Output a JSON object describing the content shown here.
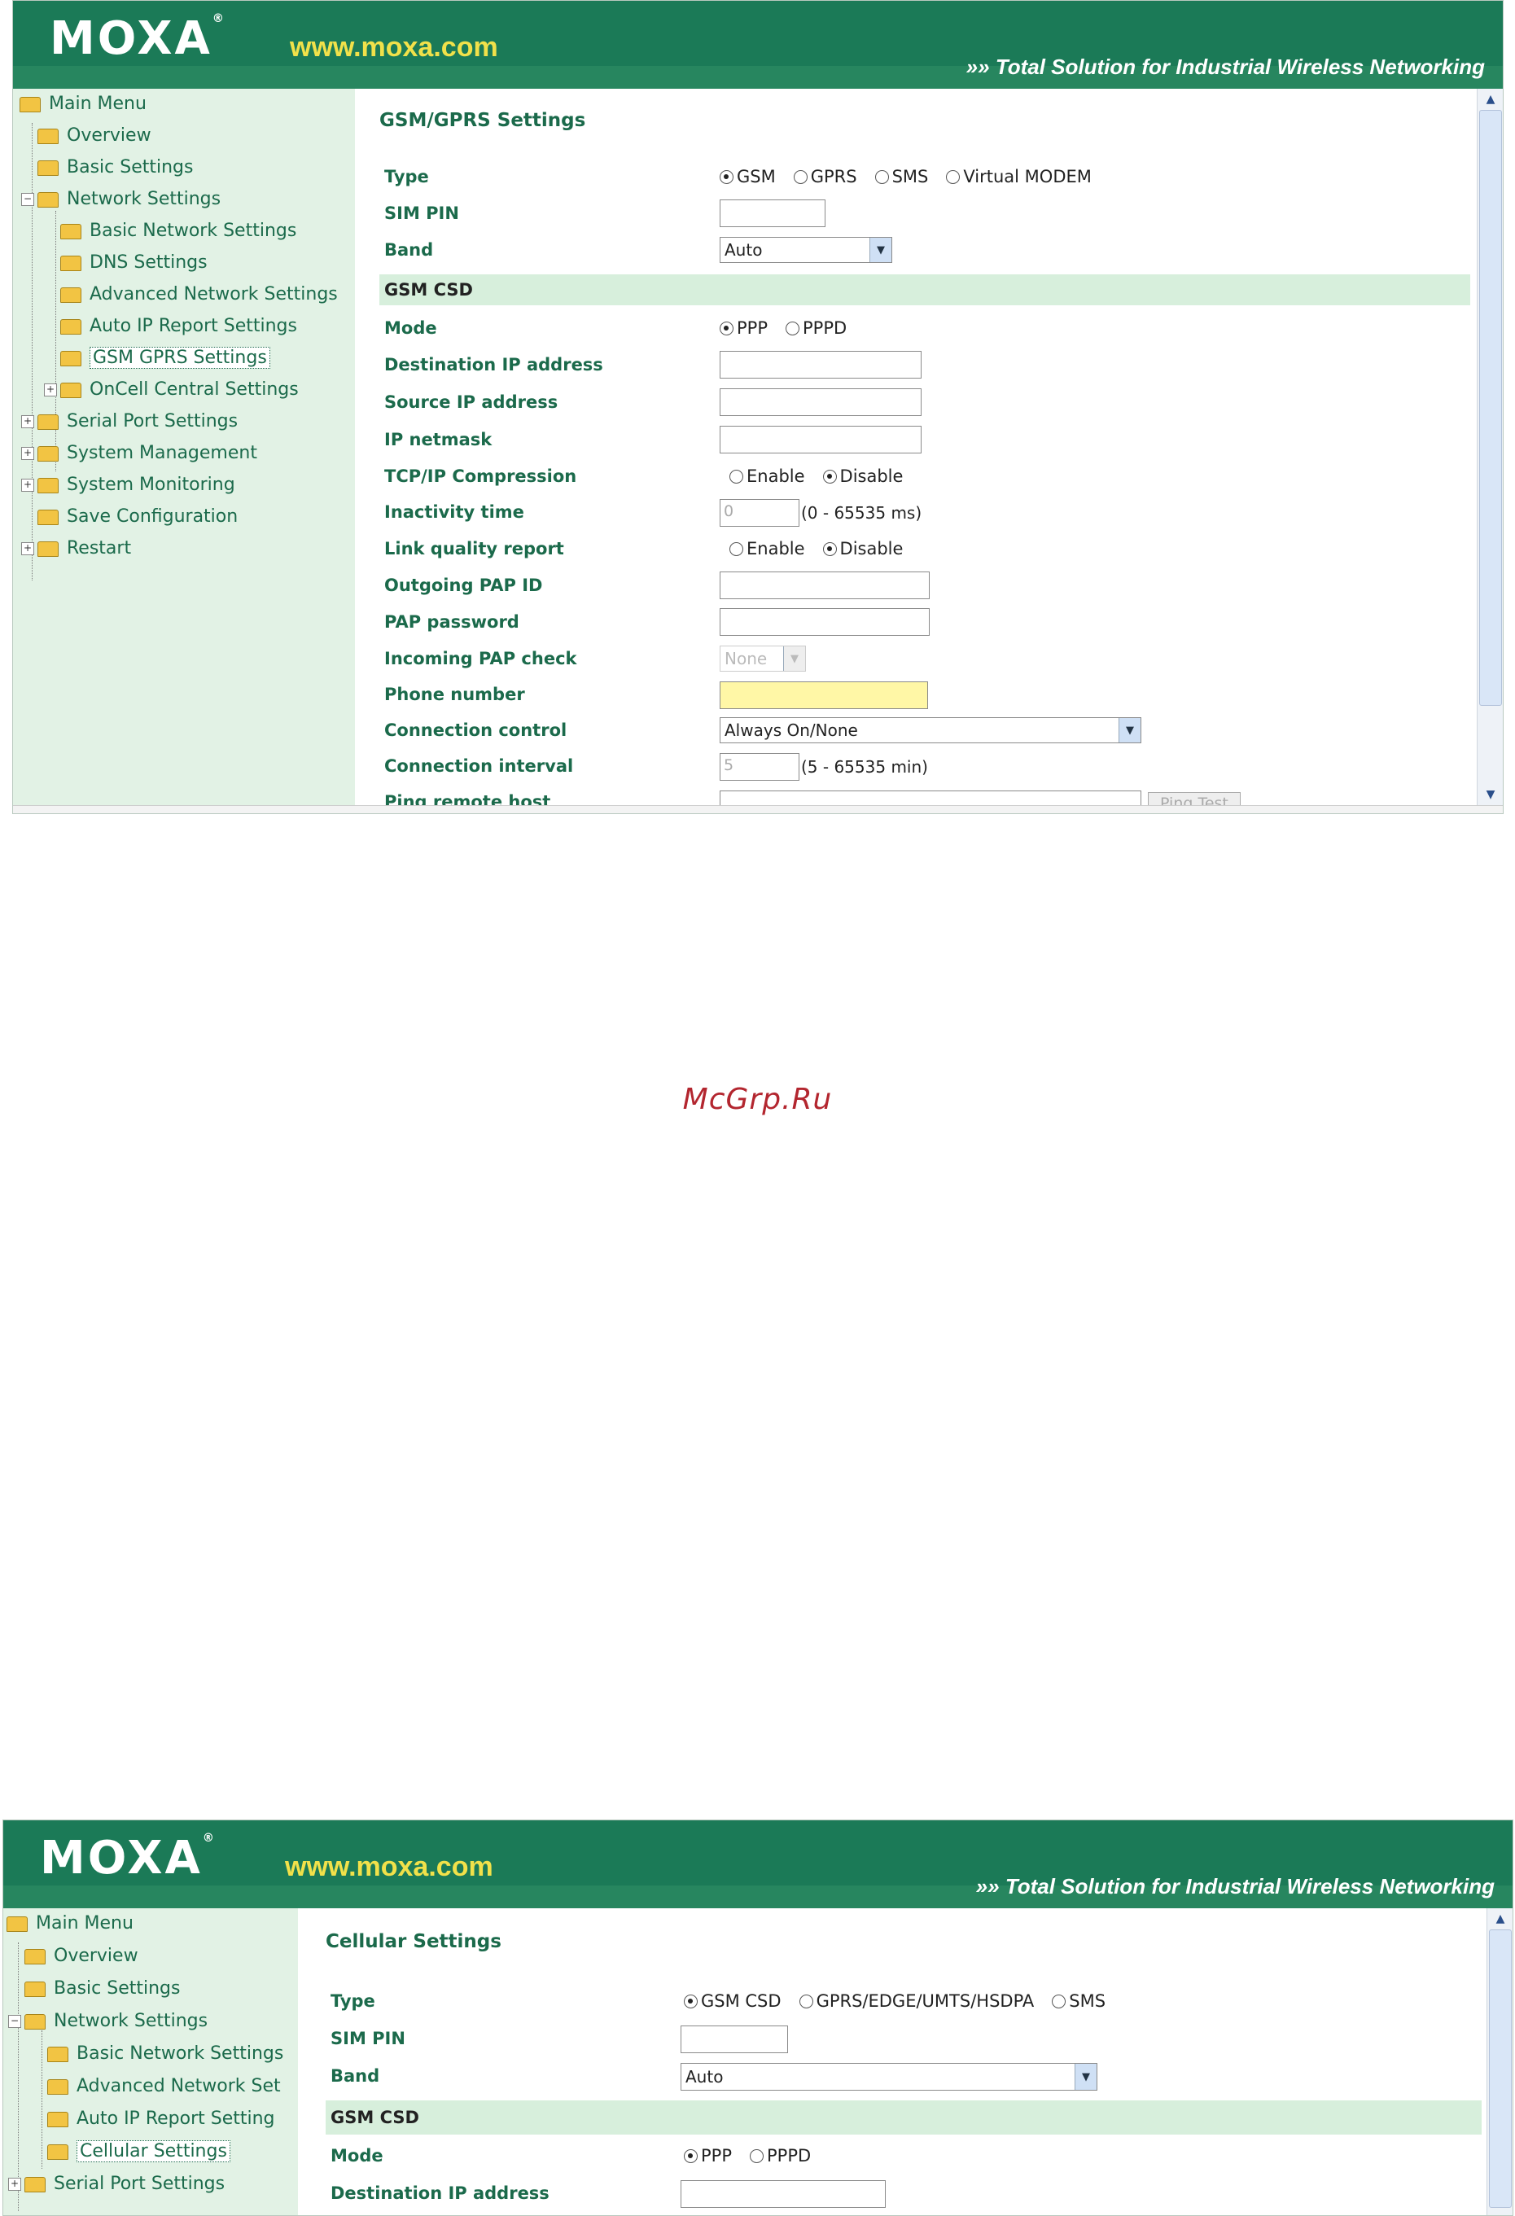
{
  "brand": {
    "logo": "MOXA",
    "url": "www.moxa.com",
    "tagline": "Total Solution for Industrial Wireless Networking"
  },
  "watermark": "McGrp.Ru",
  "shot1": {
    "page_title": "GSM/GPRS Settings",
    "menu": {
      "main": "Main Menu",
      "overview": "Overview",
      "basic_settings": "Basic Settings",
      "network_settings": "Network Settings",
      "basic_network_settings": "Basic Network Settings",
      "dns_settings": "DNS Settings",
      "advanced_network_settings": "Advanced Network Settings",
      "auto_ip_report_settings": "Auto IP Report Settings",
      "gsm_gprs_settings": "GSM GPRS Settings",
      "oncell_central_settings": "OnCell Central Settings",
      "serial_port_settings": "Serial Port Settings",
      "system_management": "System Management",
      "system_monitoring": "System Monitoring",
      "save_configuration": "Save Configuration",
      "restart": "Restart"
    },
    "type_label": "Type",
    "type_options": {
      "gsm": "GSM",
      "gprs": "GPRS",
      "sms": "SMS",
      "virtual_modem": "Virtual MODEM"
    },
    "sim_pin_label": "SIM PIN",
    "sim_pin_value": "",
    "band_label": "Band",
    "band_value": "Auto",
    "section_gsm_csd": "GSM CSD",
    "mode_label": "Mode",
    "mode_options": {
      "ppp": "PPP",
      "pppd": "PPPD"
    },
    "dest_ip_label": "Destination IP address",
    "dest_ip_value": "",
    "source_ip_label": "Source IP address",
    "source_ip_value": "",
    "netmask_label": "IP netmask",
    "netmask_value": "",
    "tcpip_comp_label": "TCP/IP Compression",
    "enable": "Enable",
    "disable": "Disable",
    "inactivity_label": "Inactivity time",
    "inactivity_value": "0",
    "inactivity_hint": "(0 - 65535 ms)",
    "link_quality_label": "Link quality report",
    "out_pap_id_label": "Outgoing PAP ID",
    "out_pap_id_value": "",
    "pap_password_label": "PAP password",
    "pap_password_value": "",
    "incoming_pap_label": "Incoming PAP check",
    "incoming_pap_value": "None",
    "phone_label": "Phone number",
    "phone_value": "",
    "conn_control_label": "Connection control",
    "conn_control_value": "Always On/None",
    "conn_interval_label": "Connection interval",
    "conn_interval_value": "5",
    "conn_interval_hint": "(5 - 65535 min)",
    "ping_label": "Ping remote host",
    "ping_button": "Ping Test"
  },
  "shot2": {
    "page_title": "Cellular Settings",
    "menu": {
      "main": "Main Menu",
      "overview": "Overview",
      "basic_settings": "Basic Settings",
      "network_settings": "Network Settings",
      "basic_network_settings": "Basic Network Settings",
      "advanced_network_settings": "Advanced Network Set",
      "auto_ip_report_settings": "Auto IP Report Setting",
      "cellular_settings": "Cellular Settings",
      "serial_port_settings": "Serial Port Settings"
    },
    "type_label": "Type",
    "type_options": {
      "gsm_csd": "GSM CSD",
      "gprs_edge": "GPRS/EDGE/UMTS/HSDPA",
      "sms": "SMS"
    },
    "sim_pin_label": "SIM PIN",
    "sim_pin_value": "",
    "band_label": "Band",
    "band_value": "Auto",
    "section_gsm_csd": "GSM CSD",
    "mode_label": "Mode",
    "mode_options": {
      "ppp": "PPP",
      "pppd": "PPPD"
    },
    "dest_ip_label": "Destination IP address",
    "dest_ip_value": ""
  }
}
